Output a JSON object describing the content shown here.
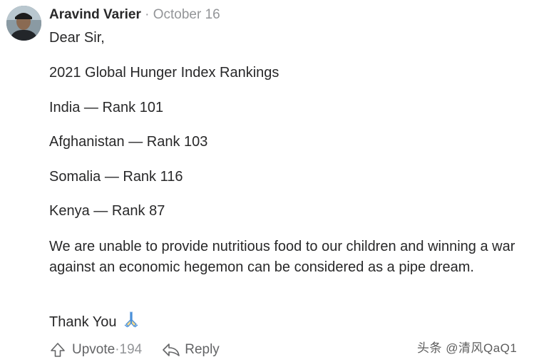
{
  "post": {
    "author": "Aravind Varier",
    "separator": " · ",
    "date": "October 16"
  },
  "body": {
    "greeting": "Dear Sir,",
    "heading": "2021 Global Hunger Index Rankings",
    "rankings": [
      "India — Rank 101",
      "Afghanistan — Rank 103",
      "Somalia — Rank 116",
      "Kenya — Rank 87"
    ],
    "paragraph": "We are unable to provide nutritious food to our children and winning a war against an economic hegemon can be considered as a pipe dream.",
    "closing": "Thank You",
    "closing_emoji": "folded-hands"
  },
  "actions": {
    "upvote_label": "Upvote",
    "upvote_separator": " · ",
    "upvote_count": "194",
    "reply_label": "Reply"
  },
  "watermark": "头条 @清风QaQ1"
}
